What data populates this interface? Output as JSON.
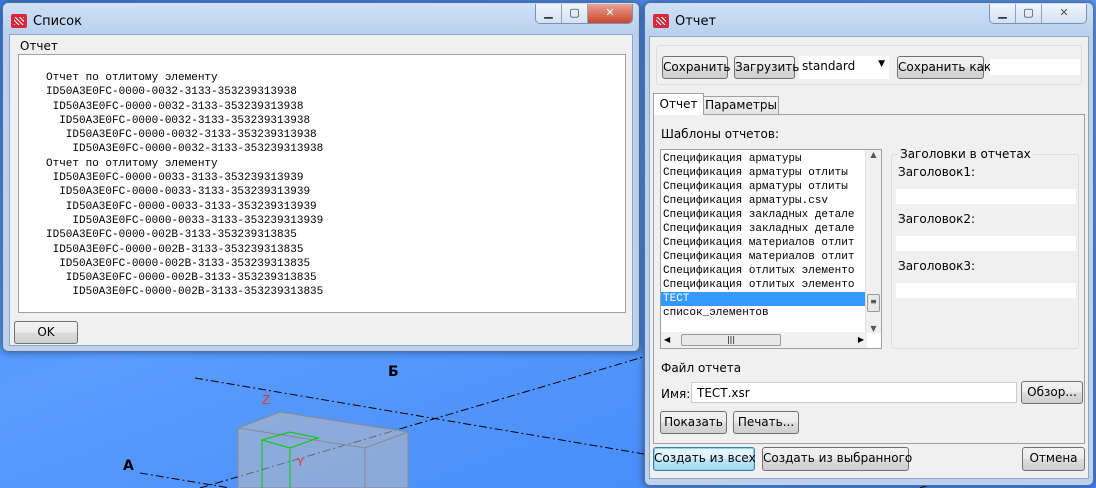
{
  "background": {
    "label_a": "А",
    "label_b": "Б",
    "axis_z": "Z",
    "axis_y": "Y"
  },
  "list_window": {
    "title": "Список",
    "group_label": "Отчет",
    "lines": [
      "Отчет по отлитому элементу",
      "ID50A3E0FC-0000-0032-3133-353239313938",
      " ID50A3E0FC-0000-0032-3133-353239313938",
      "  ID50A3E0FC-0000-0032-3133-353239313938",
      "   ID50A3E0FC-0000-0032-3133-353239313938",
      "    ID50A3E0FC-0000-0032-3133-353239313938",
      "Отчет по отлитому элементу",
      " ID50A3E0FC-0000-0033-3133-353239313939",
      "  ID50A3E0FC-0000-0033-3133-353239313939",
      "   ID50A3E0FC-0000-0033-3133-353239313939",
      "    ID50A3E0FC-0000-0033-3133-353239313939",
      "ID50A3E0FC-0000-002B-3133-353239313835",
      " ID50A3E0FC-0000-002B-3133-353239313835",
      "  ID50A3E0FC-0000-002B-3133-353239313835",
      "   ID50A3E0FC-0000-002B-3133-353239313835",
      "    ID50A3E0FC-0000-002B-3133-353239313835"
    ],
    "ok_label": "OK"
  },
  "report_window": {
    "title": "Отчет",
    "toolbar": {
      "save": "Сохранить",
      "load": "Загрузить",
      "preset": "standard",
      "save_as": "Сохранить как",
      "save_as_name": ""
    },
    "tabs": [
      {
        "label": "Отчет",
        "active": true
      },
      {
        "label": "Параметры",
        "active": false
      }
    ],
    "templates_label": "Шаблоны отчетов:",
    "templates": [
      "Спецификация арматуры",
      "Спецификация арматуры отлиты",
      "Спецификация арматуры отлиты",
      "Спецификация арматуры.csv",
      "Спецификация закладных детале",
      "Спецификация закладных детале",
      "Спецификация материалов отлит",
      "Спецификация материалов отлит",
      "Спецификация отлитых элементо",
      "Спецификация отлитых элементо",
      "ТЕСТ",
      "список_элементов"
    ],
    "selected_template": "ТЕСТ",
    "headers_group": "Заголовки в отчетах",
    "headers": [
      {
        "label": "Заголовок1:",
        "value": ""
      },
      {
        "label": "Заголовок2:",
        "value": ""
      },
      {
        "label": "Заголовок3:",
        "value": ""
      }
    ],
    "file_group": "Файл отчета",
    "name_label": "Имя:",
    "name_value": "ТЕСТ.xsr",
    "browse": "Обзор...",
    "show": "Показать",
    "print": "Печать...",
    "create_all": "Создать из всех",
    "create_selected": "Создать из выбранного",
    "cancel": "Отмена"
  }
}
